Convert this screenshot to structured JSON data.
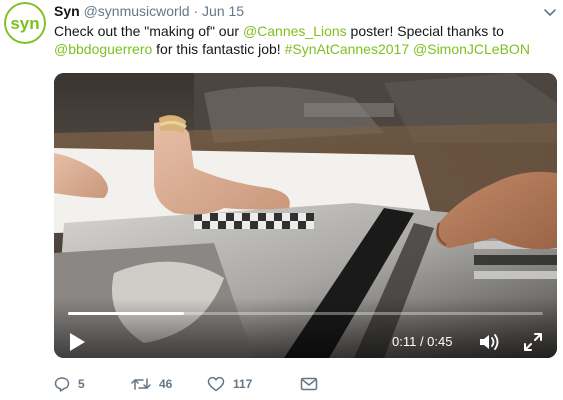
{
  "tweet": {
    "author_name": "Syn",
    "author_handle": "@synmusicworld",
    "separator": "·",
    "date": "Jun 15",
    "avatar_text": "syn",
    "text_parts": {
      "t1": "Check out the \"making of\" our ",
      "mention1": "@Cannes_Lions",
      "t2": " poster! Special thanks to ",
      "mention2": "@bbdoguerrero",
      "t3": " for this fantastic job! ",
      "hashtag": "#SynAtCannes2017",
      "t4": " ",
      "mention3": "@SimonJCLeBON"
    }
  },
  "video": {
    "time_display": "0:11 / 0:45",
    "progress_fraction": 0.244
  },
  "actions": {
    "reply_count": "5",
    "retweet_count": "46",
    "like_count": "117"
  },
  "colors": {
    "brand": "#7fbf1f",
    "icon_gray": "#657786"
  }
}
